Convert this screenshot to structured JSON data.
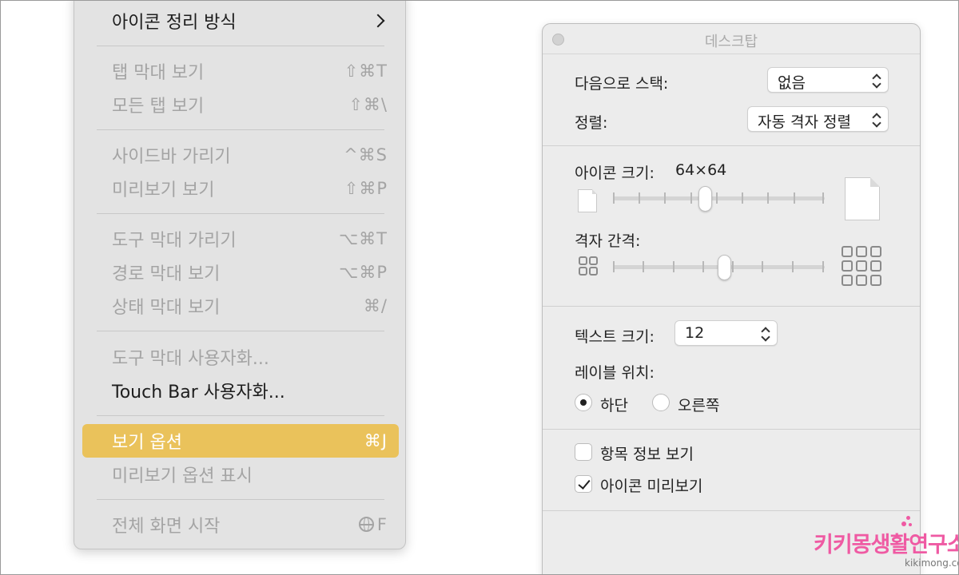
{
  "menu": {
    "items": [
      {
        "label": "아이콘 정리 방식",
        "shortcut": ""
      },
      {
        "label": "탭 막대 보기",
        "shortcut": "⇧⌘T"
      },
      {
        "label": "모든 탭 보기",
        "shortcut": "⇧⌘\\"
      },
      {
        "label": "사이드바 가리기",
        "shortcut": "^⌘S"
      },
      {
        "label": "미리보기 보기",
        "shortcut": "⇧⌘P"
      },
      {
        "label": "도구 막대 가리기",
        "shortcut": "⌥⌘T"
      },
      {
        "label": "경로 막대 보기",
        "shortcut": "⌥⌘P"
      },
      {
        "label": "상태 막대 보기",
        "shortcut": "⌘/"
      },
      {
        "label": "도구 막대 사용자화...",
        "shortcut": ""
      },
      {
        "label": "Touch Bar 사용자화...",
        "shortcut": ""
      },
      {
        "label": "보기 옵션",
        "shortcut": "⌘J"
      },
      {
        "label": "미리보기 옵션 표시",
        "shortcut": ""
      },
      {
        "label": "전체 화면 시작",
        "shortcut": "F"
      }
    ],
    "highlight_color": "#eac25b"
  },
  "panel": {
    "title": "데스크탑",
    "stack_by": {
      "label": "다음으로 스택:",
      "value": "없음"
    },
    "sort_by": {
      "label": "정렬:",
      "value": "자동 격자 정렬"
    },
    "icon_size": {
      "label": "아이콘 크기:",
      "value": "64×64",
      "slider_fraction": 0.43
    },
    "grid_spacing": {
      "label": "격자 간격:",
      "slider_fraction": 0.53
    },
    "text_size": {
      "label": "텍스트 크기:",
      "value": "12"
    },
    "label_position": {
      "label": "레이블 위치:",
      "options": [
        {
          "label": "하단",
          "selected": true
        },
        {
          "label": "오른쪽",
          "selected": false
        }
      ]
    },
    "show_item_info": {
      "label": "항목 정보 보기",
      "checked": false
    },
    "show_icon_preview": {
      "label": "아이콘 미리보기",
      "checked": true
    }
  },
  "watermark": {
    "main": "키키몽생활연구소",
    "sub": "kikimong.com",
    "color": "#ef5aa3"
  }
}
